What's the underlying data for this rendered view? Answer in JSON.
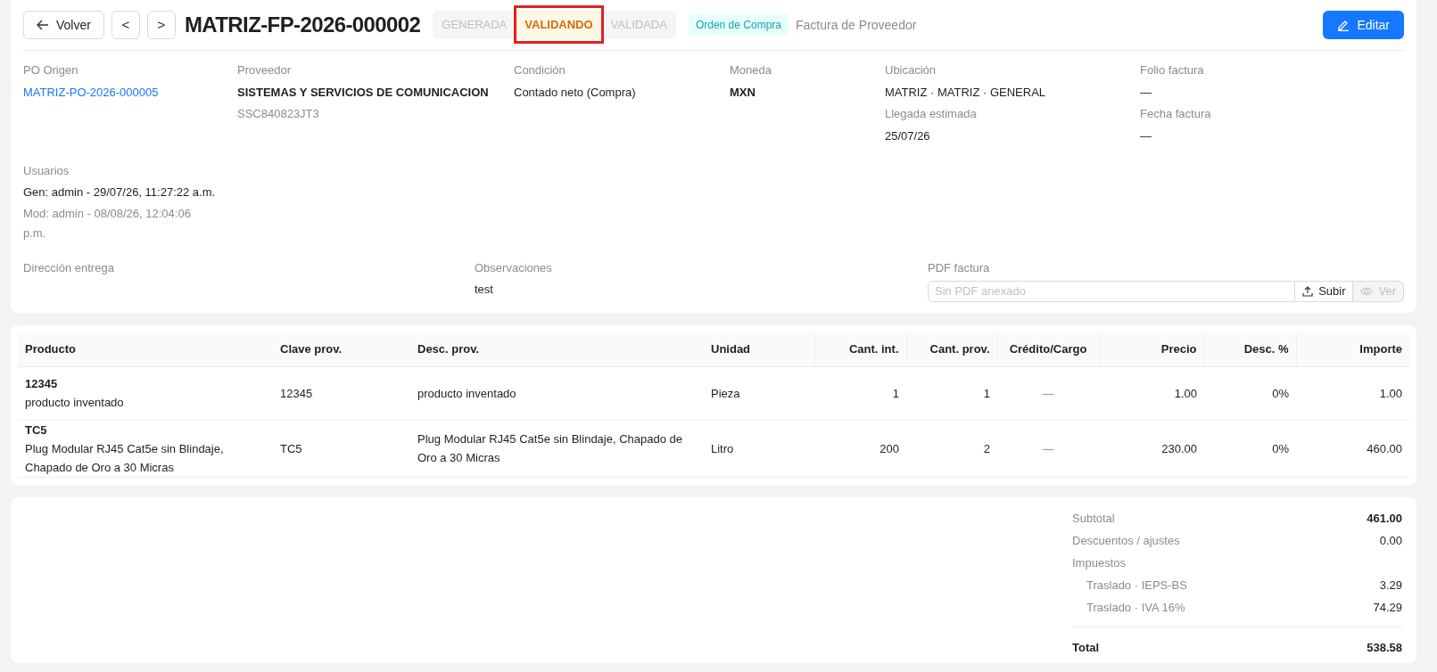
{
  "header": {
    "back_label": "Volver",
    "prev_icon": "<",
    "next_icon": ">",
    "title": "MATRIZ-FP-2026-000002",
    "steps": [
      {
        "label": "GENERADA",
        "selected": false,
        "highlighted": false
      },
      {
        "label": "VALIDANDO",
        "selected": true,
        "highlighted": true
      },
      {
        "label": "VALIDADA",
        "selected": false,
        "highlighted": false
      }
    ],
    "tag": "Orden de Compra",
    "doc_type": "Factura de Proveedor",
    "edit_label": "Editar"
  },
  "info": [
    {
      "label": "PO Origen",
      "value": "MATRIZ-PO-2026-000005",
      "kind": "link"
    },
    {
      "label": "Proveedor",
      "value": "SISTEMAS Y SERVICIOS DE COMUNICACION",
      "sub": "SSC840823JT3",
      "kind": "bold"
    },
    {
      "label": "Condición",
      "value": "Contado neto (Compra)",
      "kind": "plain"
    },
    {
      "label": "Moneda",
      "value": "MXN",
      "kind": "bold"
    },
    {
      "label": "Ubicación",
      "value": "MATRIZ · MATRIZ · GENERAL",
      "label2": "Llegada estimada",
      "value2": "25/07/26",
      "kind": "plain"
    },
    {
      "label": "Folio factura",
      "value": "—",
      "label2": "Fecha factura",
      "value2": "—",
      "kind": "plain"
    }
  ],
  "users": {
    "label": "Usuarios",
    "created": "Gen: admin - 29/07/26, 11:27:22 a.m.",
    "modified": "Mod: admin - 08/08/26, 12:04:06 p.m."
  },
  "delivery": {
    "label": "Dirección entrega"
  },
  "notes": {
    "label": "Observaciones",
    "value": "test"
  },
  "pdf": {
    "label": "PDF factura",
    "placeholder": "Sin PDF anexado",
    "upload": "Subir",
    "view": "Ver",
    "view_disabled": true
  },
  "table": {
    "columns": [
      {
        "label": "Producto",
        "kind": "text"
      },
      {
        "label": "Clave prov.",
        "kind": "text"
      },
      {
        "label": "Desc. prov.",
        "kind": "text"
      },
      {
        "label": "Unidad",
        "kind": "text"
      },
      {
        "label": "Cant. int.",
        "kind": "number"
      },
      {
        "label": "Cant. prov.",
        "kind": "number"
      },
      {
        "label": "Crédito/Cargo",
        "kind": "mark"
      },
      {
        "label": "Precio",
        "kind": "number"
      },
      {
        "label": "Desc. %",
        "kind": "number"
      },
      {
        "label": "Importe",
        "kind": "number"
      }
    ],
    "rows": [
      {
        "cells": [
          {
            "code": "12345",
            "name": "producto inventado"
          },
          "12345",
          "producto inventado",
          "Pieza",
          "1",
          "1",
          "—",
          "1.00",
          "0%",
          "1.00"
        ]
      },
      {
        "cells": [
          {
            "code": "TC5",
            "name": "Plug Modular RJ45 Cat5e sin Blindaje, Chapado de Oro a 30 Micras"
          },
          "TC5",
          "Plug Modular RJ45 Cat5e sin Blindaje, Chapado de Oro a 30 Micras",
          "Litro",
          "200",
          "2",
          "—",
          "230.00",
          "0%",
          "460.00"
        ]
      }
    ]
  },
  "totals": [
    {
      "label": "Subtotal",
      "value": "461.00",
      "kind": "strong"
    },
    {
      "label": "Descuentos / ajustes",
      "value": "0.00",
      "kind": "normal"
    },
    {
      "label": "Impuestos",
      "kind": "heading"
    },
    {
      "label": "Traslado · IEPS-BS",
      "value": "3.29",
      "kind": "sub"
    },
    {
      "label": "Traslado · IVA 16%",
      "value": "74.29",
      "kind": "sub"
    },
    {
      "label": "Total",
      "value": "538.58",
      "kind": "total"
    }
  ]
}
